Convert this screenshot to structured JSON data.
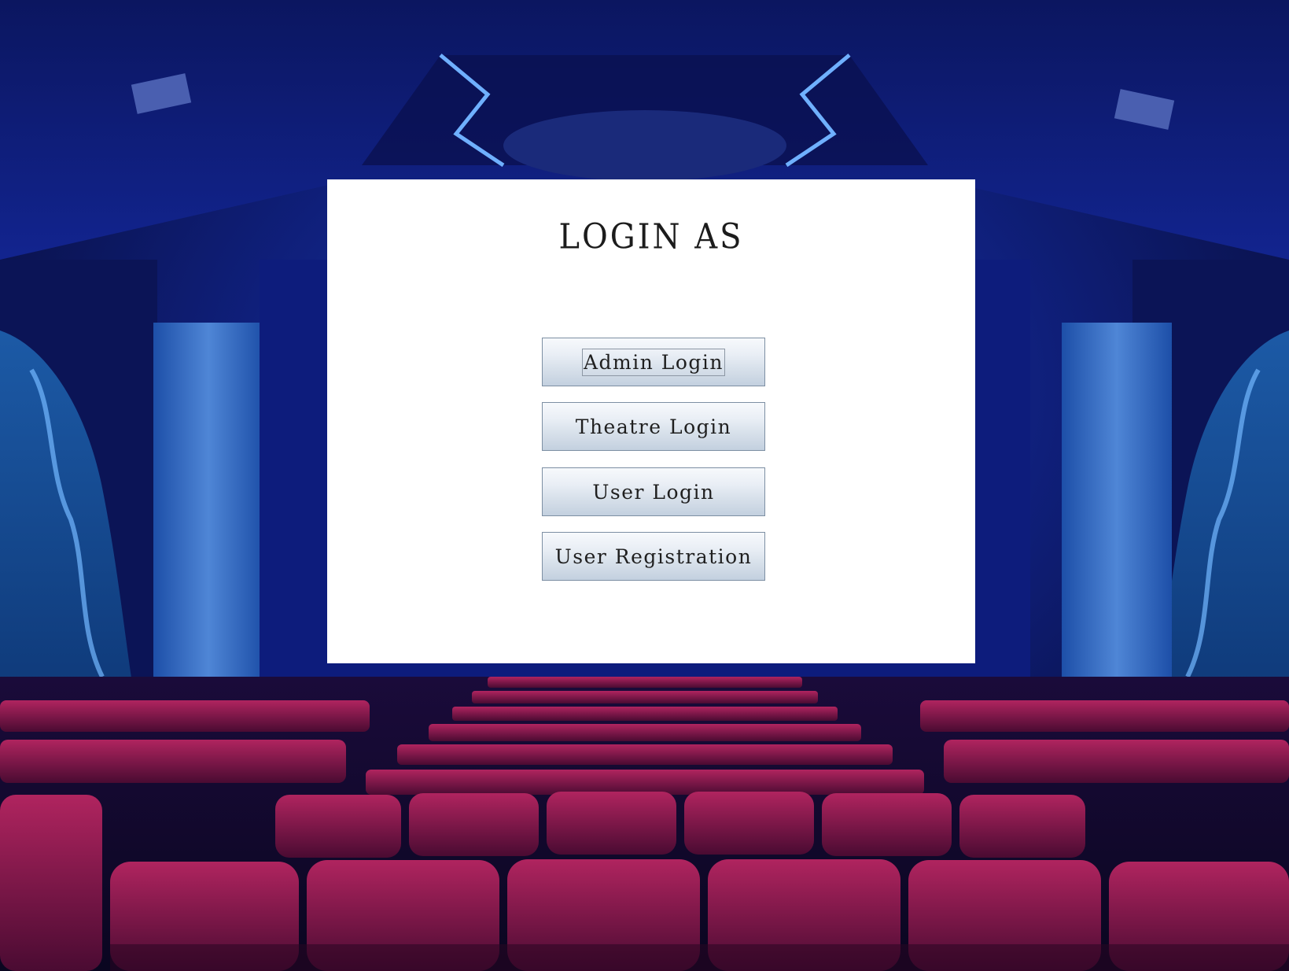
{
  "panel": {
    "title": "LOGIN AS"
  },
  "buttons": {
    "admin_login": "Admin Login",
    "theatre_login": "Theatre Login",
    "user_login": "User Login",
    "user_registration": "User Registration"
  },
  "colors": {
    "panel_background": "#ffffff",
    "button_gradient_top": "#f7f9fc",
    "button_gradient_bottom": "#c3d0df",
    "button_border": "#7d8fa3",
    "text": "#1c1c1c",
    "seat_color": "#8a1650",
    "hall_color": "#0c1a6b"
  }
}
